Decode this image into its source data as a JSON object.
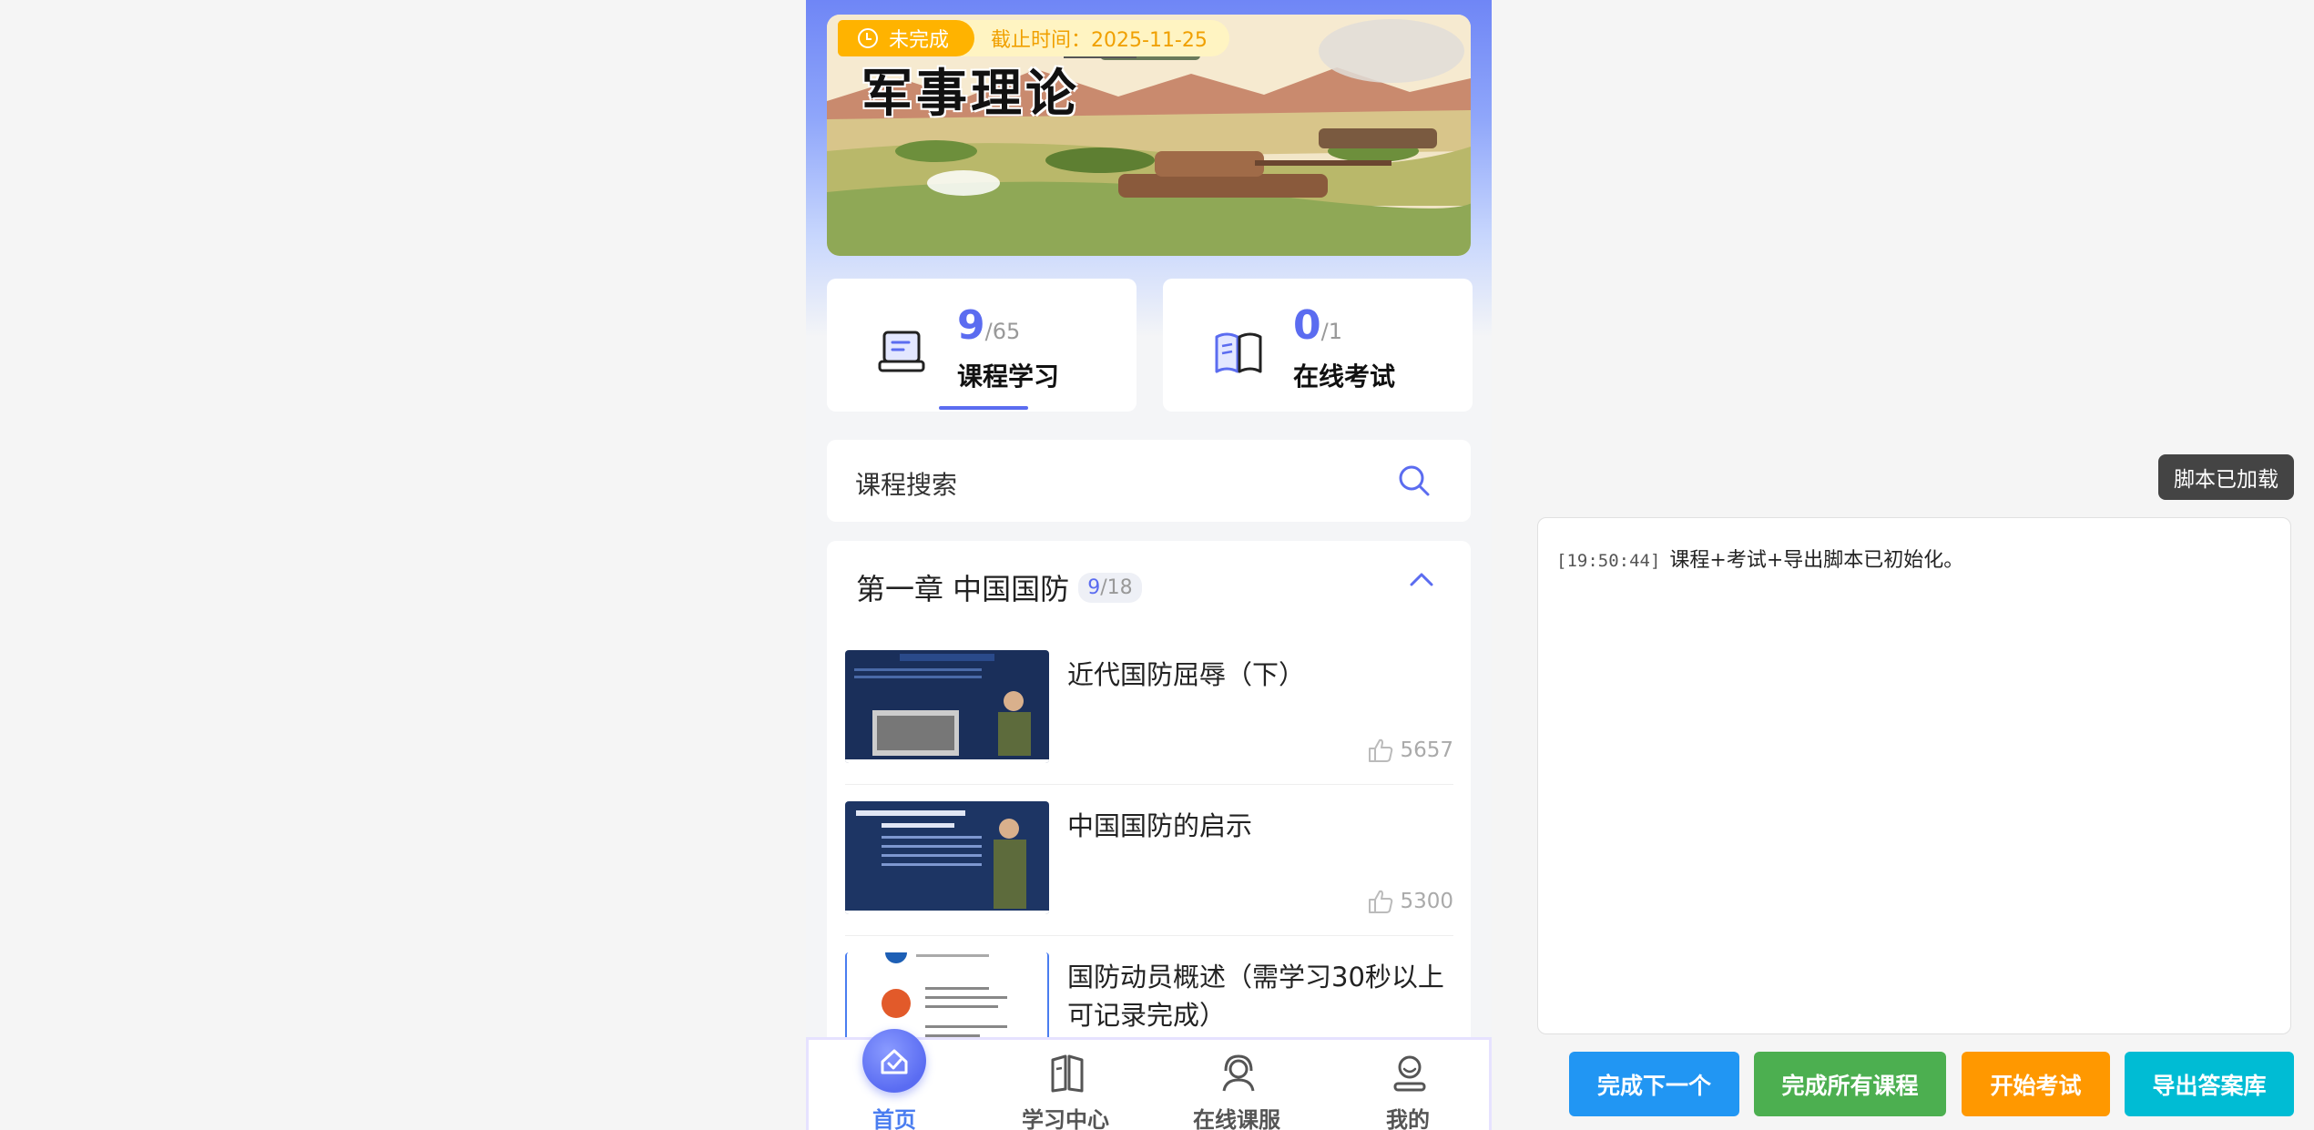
{
  "banner": {
    "status_badge": "未完成",
    "deadline": "截止时间：2025-11-25",
    "title": "军事理论"
  },
  "stats": {
    "course": {
      "done": "9",
      "total": "/65",
      "label": "课程学习"
    },
    "exam": {
      "done": "0",
      "total": "/1",
      "label": "在线考试"
    }
  },
  "search": {
    "placeholder": "课程搜索"
  },
  "chapter": {
    "title": "第一章 中国国防",
    "done": "9",
    "total": "/18",
    "courses": [
      {
        "title": "近代国防屈辱（下）",
        "likes": "5657"
      },
      {
        "title": "中国国防的启示",
        "likes": "5300"
      },
      {
        "title": "国防动员概述（需学习30秒以上可记录完成）",
        "likes": ""
      }
    ]
  },
  "tabbar": {
    "items": [
      {
        "label": "首页",
        "icon": "home-icon",
        "active": true
      },
      {
        "label": "学习中心",
        "icon": "book-icon",
        "active": false
      },
      {
        "label": "在线课服",
        "icon": "headset-icon",
        "active": false
      },
      {
        "label": "我的",
        "icon": "user-icon",
        "active": false
      }
    ]
  },
  "script_panel": {
    "tooltip": "脚本已加载",
    "log": {
      "time": "[19:50:44]",
      "message": "课程+考试+导出脚本已初始化。"
    },
    "buttons": {
      "next": "完成下一个",
      "all": "完成所有课程",
      "exam": "开始考试",
      "export": "导出答案库"
    }
  },
  "colors": {
    "accent": "#5b6cf0",
    "status_orange": "#ffb300",
    "btn_blue": "#2196f3",
    "btn_green": "#4caf50",
    "btn_orange": "#ff9800",
    "btn_cyan": "#00bcd4"
  }
}
